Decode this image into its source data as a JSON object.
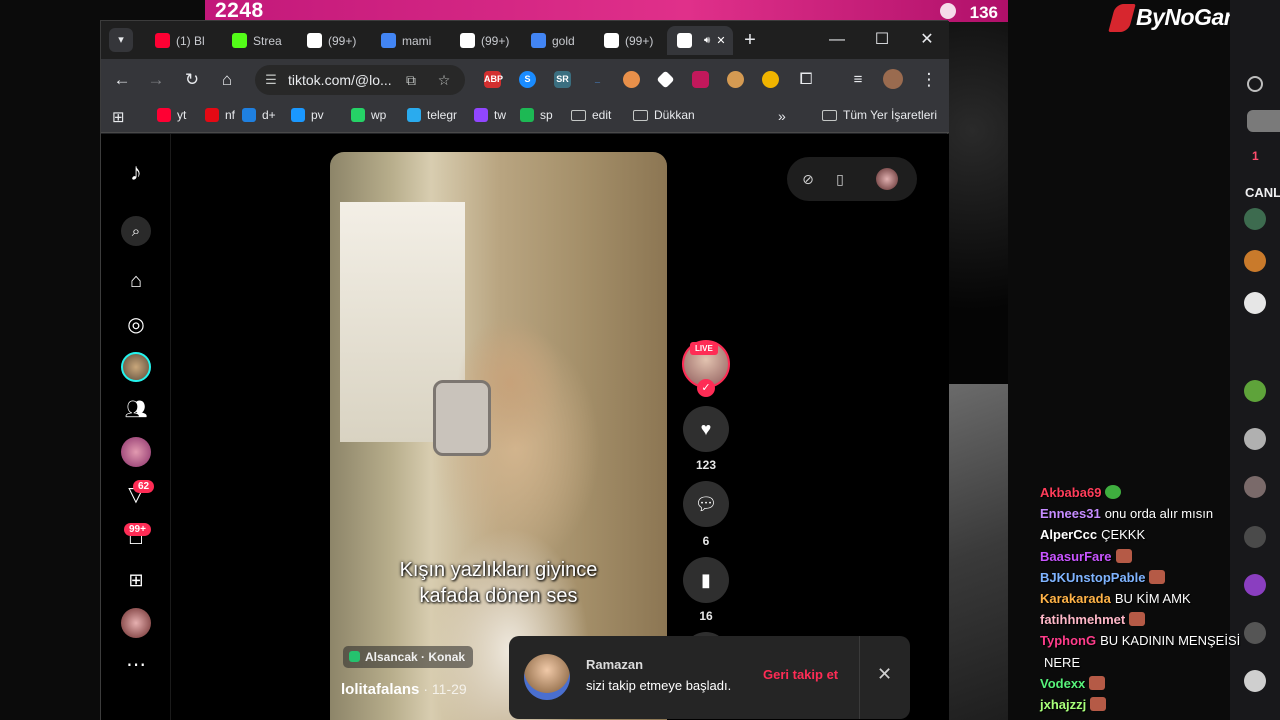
{
  "overlay": {
    "left_count": "2248",
    "right_count": "136",
    "brand": "ByNoGame"
  },
  "browser": {
    "tabs": [
      {
        "label": "(1) Bl",
        "icon": "youtube-icon",
        "color": "#ff0033"
      },
      {
        "label": "Strea",
        "icon": "kick-icon",
        "color": "#53fc18"
      },
      {
        "label": "(99+)",
        "icon": "tiktok-icon",
        "color": "#ffffff"
      },
      {
        "label": "mami",
        "icon": "google-icon",
        "color": "#4285f4"
      },
      {
        "label": "(99+)",
        "icon": "tiktok-icon",
        "color": "#ffffff"
      },
      {
        "label": "gold",
        "icon": "google-icon",
        "color": "#4285f4"
      },
      {
        "label": "(99+)",
        "icon": "tiktok-icon",
        "color": "#ffffff"
      },
      {
        "label": "",
        "icon": "tiktok-icon",
        "color": "#ffffff",
        "active": true
      }
    ],
    "url": "tiktok.com/@lo...",
    "bookmarks": [
      {
        "label": "yt",
        "color": "#ff0033"
      },
      {
        "label": "nf",
        "color": "#e50914"
      },
      {
        "label": "d+",
        "color": "#1f80e0"
      },
      {
        "label": "pv",
        "color": "#1a98ff"
      },
      {
        "label": "wp",
        "color": "#25d366"
      },
      {
        "label": "telegr",
        "color": "#2aabee"
      },
      {
        "label": "tw",
        "color": "#9146ff"
      },
      {
        "label": "sp",
        "color": "#1db954"
      },
      {
        "label": "edit",
        "color": ""
      },
      {
        "label": "Dükkan",
        "color": ""
      }
    ],
    "bookmarks_more": "»",
    "all_bookmarks": "Tüm Yer İşaretleri"
  },
  "tiktok": {
    "sidebar_badges": {
      "activity": "62",
      "inbox": "99+"
    },
    "caption_line1": "Kışın yazlıkları giyince",
    "caption_line2": "kafada dönen ses",
    "location": "Alsancak · Konak",
    "author": "lolitafalans",
    "date": "· 11-29",
    "live_label": "LIVE",
    "likes": "123",
    "comments": "6",
    "saves": "16",
    "toast": {
      "name": "Ramazan",
      "message": "sizi takip etmeye başladı.",
      "follow_back": "Geri takip et"
    }
  },
  "panel": {
    "title": "CANL",
    "number": "1"
  },
  "chat": [
    {
      "user": "Akbaba69",
      "color": "#ff3d5a",
      "msg": "",
      "emote": "green"
    },
    {
      "user": "Ennees31",
      "color": "#c58cff",
      "msg": "onu orda alır mısın",
      "emote": ""
    },
    {
      "user": "AlperCcc",
      "color": "#ffffff",
      "msg": "ÇEKKK",
      "emote": ""
    },
    {
      "user": "BaasurFare",
      "color": "#c855ff",
      "msg": "",
      "emote": "brown"
    },
    {
      "user": "BJKUnstopPable",
      "color": "#7fb4ff",
      "msg": "",
      "emote": "brown"
    },
    {
      "user": "Karakarada",
      "color": "#ffb347",
      "msg": "BU KİM AMK",
      "emote": ""
    },
    {
      "user": "fatihhmehmet",
      "color": "#ffb8c8",
      "msg": "",
      "emote": "brown"
    },
    {
      "user": "TyphonG",
      "color": "#ff3d8b",
      "msg": "BU KADININ MENŞEİSİ",
      "emote": ""
    },
    {
      "user": "",
      "color": "#ffffff",
      "msg": "NERE",
      "emote": ""
    },
    {
      "user": "Vodexx",
      "color": "#57f27a",
      "msg": "",
      "emote": "brown"
    },
    {
      "user": "jxhajzzj",
      "color": "#a8ff7a",
      "msg": "",
      "emote": "brown"
    }
  ]
}
